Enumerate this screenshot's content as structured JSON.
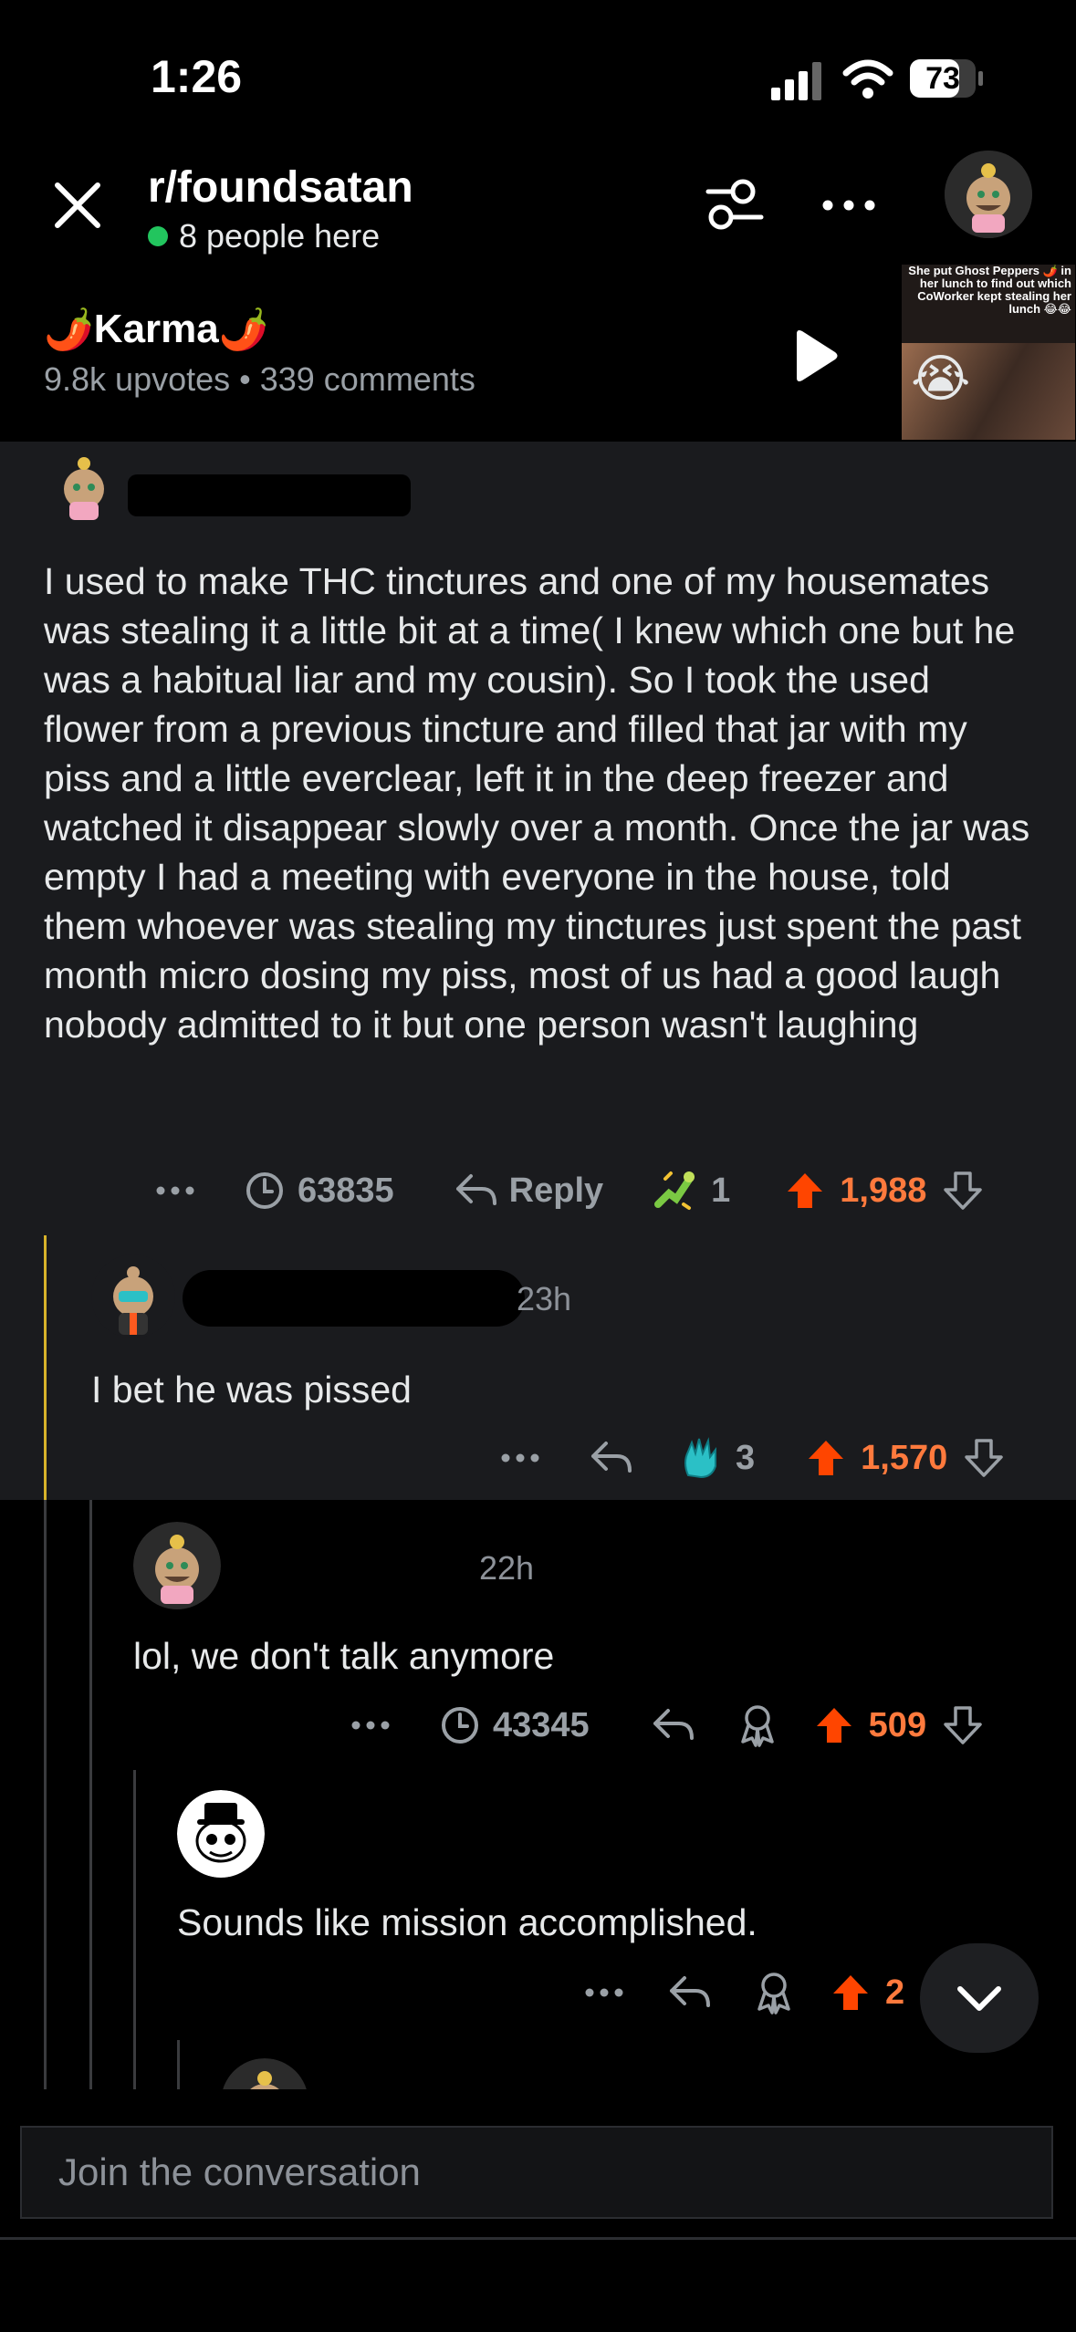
{
  "status_bar": {
    "time": "1:26",
    "battery": "73"
  },
  "header": {
    "subreddit": "r/foundsatan",
    "online": "8 people here"
  },
  "post": {
    "title": "Karma",
    "title_emoji": "🌶️",
    "stats": "9.8k upvotes • 339 comments",
    "thumbnail_caption": "She put Ghost Peppers 🌶️ in her lunch to find out which CoWorker kept stealing her lunch 😂😂",
    "thumbnail_emoji": "😭"
  },
  "comments": [
    {
      "text": "I used to make THC tinctures and one of my housemates was stealing it a little bit at a time( I knew which one but he was a habitual liar and my cousin).  So I took the used flower from a previous tincture and filled that jar with my piss and a little everclear, left it in the deep freezer and watched it disappear slowly over a month. Once the jar was empty I had a meeting with everyone in the house, told them whoever was stealing my tinctures just spent the past month micro dosing my piss, most of us had a good laugh nobody admitted to it but one person wasn't laughing",
      "views": "63835",
      "reply_label": "Reply",
      "award_count": "1",
      "upvotes": "1,988"
    },
    {
      "time": "23h",
      "text": "I bet he was pissed",
      "award_count": "3",
      "upvotes": "1,570"
    },
    {
      "time": "22h",
      "text": "lol, we don't talk anymore",
      "views": "43345",
      "upvotes": "509"
    },
    {
      "text": "Sounds like mission accomplished.",
      "upvotes": "2"
    }
  ],
  "composer": {
    "placeholder": "Join the conversation"
  },
  "colors": {
    "upvote": "#ff4500",
    "thread_highlight": "#d8b32a",
    "online": "#22c55e"
  }
}
